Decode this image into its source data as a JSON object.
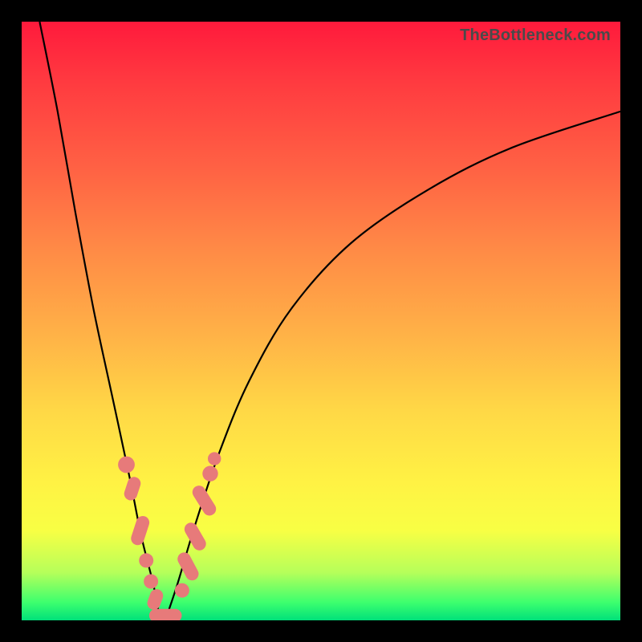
{
  "watermark": {
    "text": "TheBottleneck.com"
  },
  "colors": {
    "gradient_top": "#ff1a3c",
    "gradient_mid1": "#ff8a46",
    "gradient_mid2": "#fff244",
    "gradient_bottom": "#00e07a",
    "curve": "#000000",
    "bead": "#e77a7a",
    "frame": "#000000"
  },
  "chart_data": {
    "type": "line",
    "title": "",
    "xlabel": "",
    "ylabel": "",
    "xlim": [
      0,
      100
    ],
    "ylim": [
      0,
      100
    ],
    "note": "Axes are unlabeled; values are pixel-fraction estimates (0–100) of the plot area. y=0 is the bottom (green), y=100 is the top (red). Two monotone curves descend to a shared minimum near x≈23, y≈0, then the right curve rises back up.",
    "series": [
      {
        "name": "left-curve",
        "x": [
          3,
          6,
          9,
          12,
          15,
          18,
          20,
          22,
          23,
          24
        ],
        "y": [
          100,
          85,
          68,
          52,
          38,
          24,
          14,
          6,
          1,
          0
        ]
      },
      {
        "name": "right-curve",
        "x": [
          24,
          26,
          29,
          33,
          38,
          45,
          55,
          68,
          82,
          100
        ],
        "y": [
          0,
          6,
          16,
          28,
          40,
          52,
          63,
          72,
          79,
          85
        ]
      }
    ],
    "markers": {
      "name": "salmon-beads",
      "note": "Clustered salmon-colored oval/capsule markers along both curves near the minimum.",
      "points": [
        {
          "x": 17.5,
          "y": 26,
          "shape": "circle",
          "r": 1.4
        },
        {
          "x": 18.5,
          "y": 22,
          "shape": "capsule",
          "len": 4,
          "angle": -72
        },
        {
          "x": 19.8,
          "y": 15,
          "shape": "capsule",
          "len": 5,
          "angle": -72
        },
        {
          "x": 20.8,
          "y": 10,
          "shape": "circle",
          "r": 1.2
        },
        {
          "x": 21.6,
          "y": 6.5,
          "shape": "circle",
          "r": 1.2
        },
        {
          "x": 22.3,
          "y": 3.5,
          "shape": "capsule",
          "len": 3.5,
          "angle": -70
        },
        {
          "x": 23.3,
          "y": 0.8,
          "shape": "capsule",
          "len": 4,
          "angle": 0
        },
        {
          "x": 25.0,
          "y": 0.8,
          "shape": "capsule",
          "len": 3.5,
          "angle": 0
        },
        {
          "x": 26.8,
          "y": 5,
          "shape": "circle",
          "r": 1.2
        },
        {
          "x": 27.8,
          "y": 9,
          "shape": "capsule",
          "len": 5,
          "angle": 62
        },
        {
          "x": 29.0,
          "y": 14,
          "shape": "capsule",
          "len": 5,
          "angle": 60
        },
        {
          "x": 30.5,
          "y": 20,
          "shape": "capsule",
          "len": 5.5,
          "angle": 58
        },
        {
          "x": 31.5,
          "y": 24.5,
          "shape": "circle",
          "r": 1.3
        },
        {
          "x": 32.2,
          "y": 27,
          "shape": "circle",
          "r": 1.1
        }
      ]
    }
  }
}
